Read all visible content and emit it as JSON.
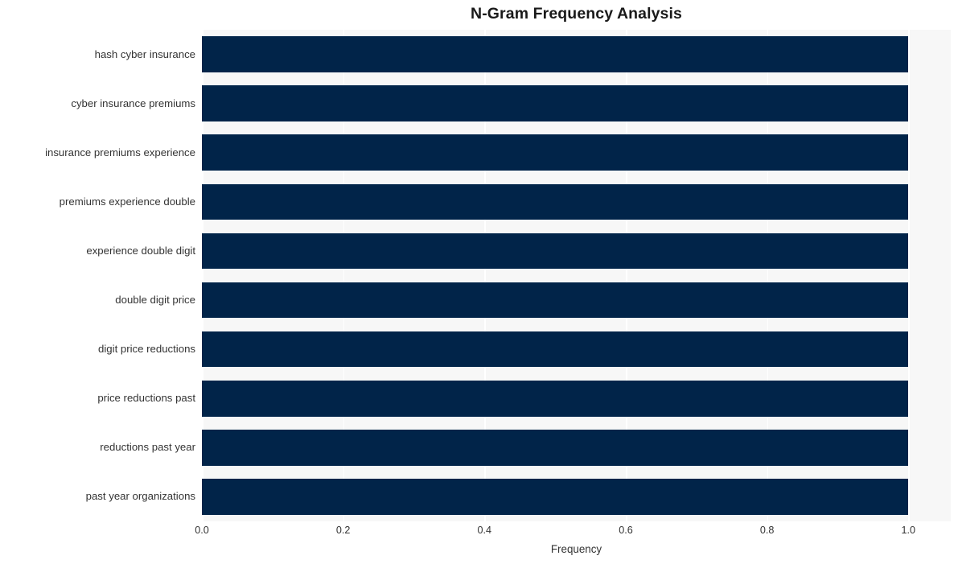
{
  "chart_data": {
    "type": "bar",
    "orientation": "horizontal",
    "title": "N-Gram Frequency Analysis",
    "xlabel": "Frequency",
    "ylabel": "",
    "xlim": [
      0,
      1.06
    ],
    "xticks": [
      "0.0",
      "0.2",
      "0.4",
      "0.6",
      "0.8",
      "1.0"
    ],
    "xtick_values": [
      0.0,
      0.2,
      0.4,
      0.6,
      0.8,
      1.0
    ],
    "grid": true,
    "grid_axis": "x",
    "legend": null,
    "bar_color": "#012449",
    "plot_background": "#f7f7f7",
    "gridline_color": "#ffffff",
    "categories": [
      "hash cyber insurance",
      "cyber insurance premiums",
      "insurance premiums experience",
      "premiums experience double",
      "experience double digit",
      "double digit price",
      "digit price reductions",
      "price reductions past",
      "reductions past year",
      "past year organizations"
    ],
    "values": [
      1.0,
      1.0,
      1.0,
      1.0,
      1.0,
      1.0,
      1.0,
      1.0,
      1.0,
      1.0
    ]
  }
}
